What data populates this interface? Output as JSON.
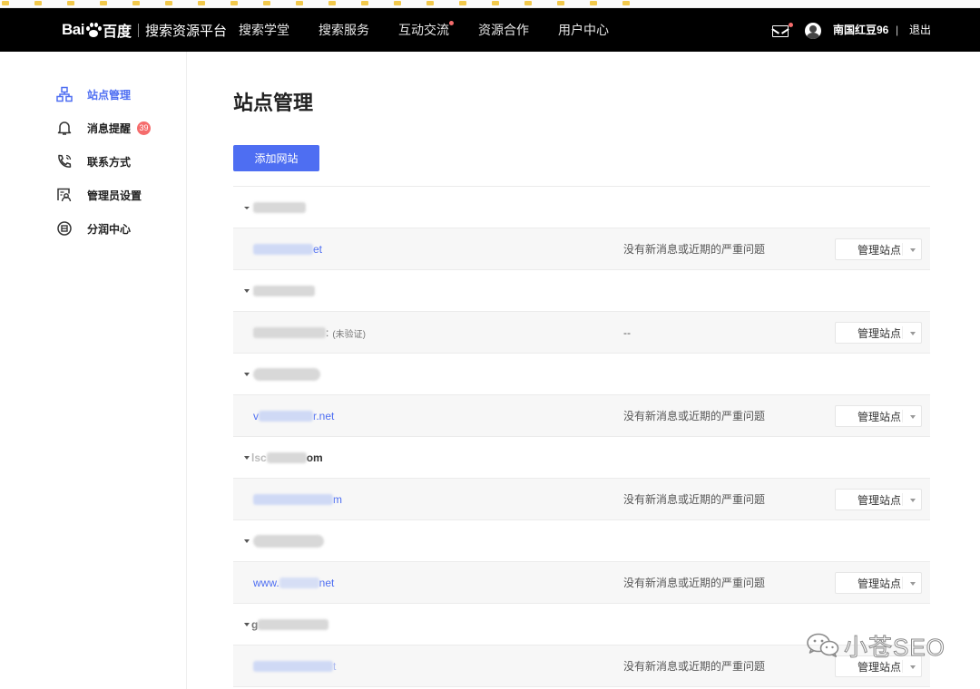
{
  "header": {
    "logo_bai": "Bai",
    "logo_du": "百度",
    "platform": "搜索资源平台",
    "nav": [
      {
        "label": "搜索学堂"
      },
      {
        "label": "搜索服务"
      },
      {
        "label": "互动交流"
      },
      {
        "label": "资源合作"
      },
      {
        "label": "用户中心"
      }
    ],
    "username": "南国红豆96",
    "separator": "|",
    "logout": "退出"
  },
  "sidebar": {
    "items": [
      {
        "label": "站点管理",
        "icon": "sitemap-icon"
      },
      {
        "label": "消息提醒",
        "icon": "bell-icon",
        "badge": "39"
      },
      {
        "label": "联系方式",
        "icon": "phone-icon"
      },
      {
        "label": "管理员设置",
        "icon": "admin-icon"
      },
      {
        "label": "分润中心",
        "icon": "share-icon"
      }
    ]
  },
  "main": {
    "title": "站点管理",
    "add_button": "添加网站",
    "groups": [
      {
        "name_prefix": "",
        "name_suffix": "",
        "domain_prefix": "",
        "domain_suffix": "et",
        "unverified": "",
        "status": "没有新消息或近期的严重问题",
        "action": "管理站点"
      },
      {
        "name_prefix": "",
        "name_suffix": "",
        "domain_prefix": "",
        "domain_suffix": ":",
        "unverified": "(未验证)",
        "status": "--",
        "action": "管理站点"
      },
      {
        "name_prefix": "",
        "name_suffix": "",
        "domain_prefix": "v",
        "domain_suffix": "r.net",
        "unverified": "",
        "status": "没有新消息或近期的严重问题",
        "action": "管理站点"
      },
      {
        "name_prefix": "lsc",
        "name_suffix": "om",
        "domain_prefix": "",
        "domain_suffix": "m",
        "unverified": "",
        "status": "没有新消息或近期的严重问题",
        "action": "管理站点"
      },
      {
        "name_prefix": "",
        "name_suffix": "",
        "domain_prefix": "www.",
        "domain_suffix": "net",
        "unverified": "",
        "status": "没有新消息或近期的严重问题",
        "action": "管理站点"
      },
      {
        "name_prefix": "g",
        "name_suffix": "",
        "domain_prefix": "",
        "domain_suffix": "t",
        "unverified": "",
        "status": "没有新消息或近期的严重问题",
        "action": "管理站点"
      }
    ]
  },
  "watermark": {
    "text": "小苍SEO",
    "icon": "wechat-icon"
  },
  "colors": {
    "accent": "#4e6ef2",
    "badge": "#f56c6c",
    "nav_bg": "#000000"
  }
}
